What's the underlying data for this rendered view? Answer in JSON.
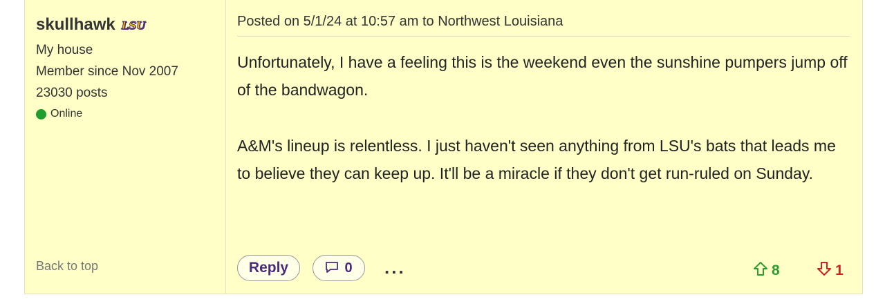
{
  "user": {
    "name": "skullhawk",
    "team_logo_text": "LSU",
    "location": "My house",
    "member_since": "Member since Nov 2007",
    "posts": "23030 posts",
    "status": "Online"
  },
  "sidebar": {
    "back_to_top": "Back to top"
  },
  "post": {
    "header": "Posted on 5/1/24 at 10:57 am to Northwest Louisiana",
    "paragraphs": [
      "Unfortunately, I have a feeling this is the weekend even the sunshine pumpers jump off of the bandwagon.",
      "A&M's lineup is relentless. I just haven't seen anything from LSU's bats that leads me to believe they can keep up. It'll be a miracle if they don't get run-ruled on Sunday."
    ]
  },
  "actions": {
    "reply_label": "Reply",
    "comment_count": "0",
    "more_label": "...",
    "upvotes": "8",
    "downvotes": "1"
  },
  "colors": {
    "post_background": "#ffffc8",
    "online": "#1f9d2e",
    "upvote": "#2e9b2e",
    "downvote": "#d12020",
    "accent_purple": "#4b2a7a",
    "lsu_gold": "#f2c300"
  },
  "icons": {
    "comment": "speech-bubble-icon",
    "upvote": "arrow-up-outline-icon",
    "downvote": "arrow-down-outline-icon",
    "online": "green-dot-icon"
  }
}
